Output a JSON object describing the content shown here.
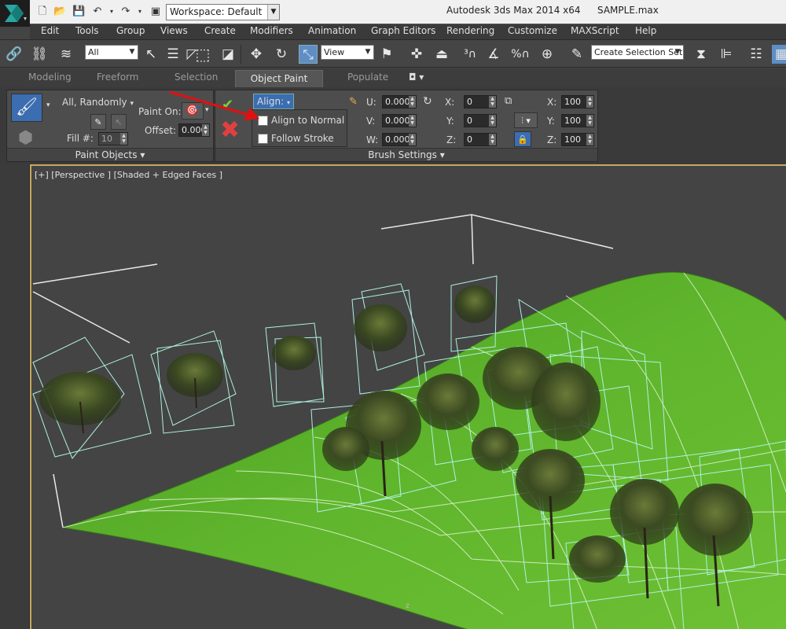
{
  "window": {
    "app_title": "Autodesk 3ds Max  2014 x64",
    "file_name": "SAMPLE.max",
    "workspace": "Workspace: Default"
  },
  "menu": [
    "Edit",
    "Tools",
    "Group",
    "Views",
    "Create",
    "Modifiers",
    "Animation",
    "Graph Editors",
    "Rendering",
    "Customize",
    "MAXScript",
    "Help"
  ],
  "toolbar": {
    "selection_filter": "All",
    "reference_coord": "View",
    "named_selection_placeholder": "Create Selection Set"
  },
  "ribbon_tabs": [
    "Modeling",
    "Freeform",
    "Selection",
    "Object Paint",
    "Populate"
  ],
  "active_tab": "Object Paint",
  "paint_objects": {
    "mode": "All, Randomly",
    "fill_label": "Fill #:",
    "fill_value": "10",
    "paint_on_label": "Paint On:",
    "offset_label": "Offset:",
    "offset_value": "0.000",
    "footer": "Paint Objects"
  },
  "align_menu": {
    "button": "Align:",
    "items": [
      {
        "label": "Align to Normal",
        "checked": false
      },
      {
        "label": "Follow Stroke",
        "checked": false
      }
    ]
  },
  "brush_settings": {
    "footer": "Brush Settings",
    "uvw": [
      {
        "label": "U:",
        "value": "0.000"
      },
      {
        "label": "V:",
        "value": "0.000"
      },
      {
        "label": "W:",
        "value": "0.000"
      }
    ],
    "rotate": [
      {
        "label": "X:",
        "value": "0"
      },
      {
        "label": "Y:",
        "value": "0"
      },
      {
        "label": "Z:",
        "value": "0"
      }
    ],
    "scale": [
      {
        "label": "X:",
        "value": "100"
      },
      {
        "label": "Y:",
        "value": "100"
      },
      {
        "label": "Z:",
        "value": "100"
      }
    ]
  },
  "viewport": {
    "label": "[+] [Perspective ] [Shaded + Edged Faces ]",
    "axis_label": "z"
  },
  "colors": {
    "terrain": "#5fb52c",
    "wire": "#aef0e0",
    "annotation_arrow": "#e01010"
  }
}
